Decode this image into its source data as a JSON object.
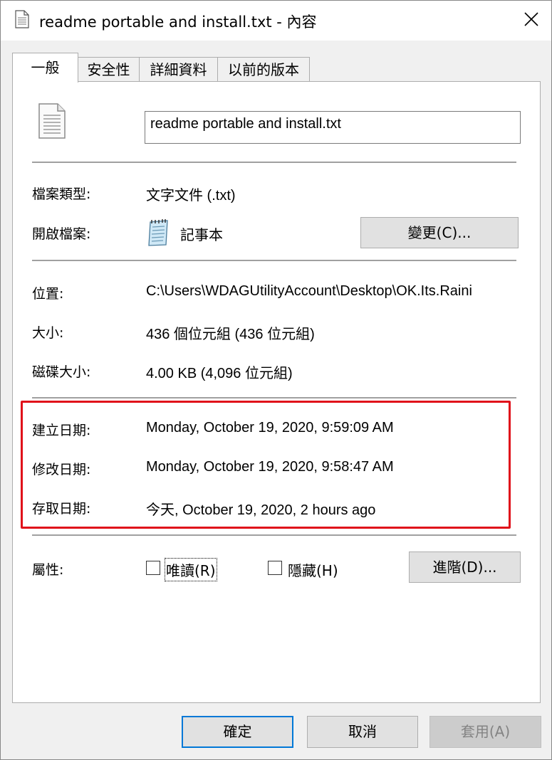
{
  "window": {
    "title": "readme portable and install.txt - 內容"
  },
  "tabs": [
    {
      "label": "一般",
      "active": true
    },
    {
      "label": "安全性",
      "active": false
    },
    {
      "label": "詳細資料",
      "active": false
    },
    {
      "label": "以前的版本",
      "active": false
    }
  ],
  "general": {
    "file_name": "readme portable and install.txt",
    "file_type_label": "檔案類型:",
    "file_type_value": "文字文件 (.txt)",
    "opens_with_label": "開啟檔案:",
    "opens_with_value": "記事本",
    "change_button": "變更(C)...",
    "location_label": "位置:",
    "location_value": "C:\\Users\\WDAGUtilityAccount\\Desktop\\OK.Its.Raini",
    "size_label": "大小:",
    "size_value": "436 個位元組 (436 位元組)",
    "size_on_disk_label": "磁碟大小:",
    "size_on_disk_value": "4.00 KB (4,096 位元組)",
    "created_label": "建立日期:",
    "created_value": "Monday, October 19, 2020, 9:59:09 AM",
    "modified_label": "修改日期:",
    "modified_value": "Monday, October 19, 2020, 9:58:47 AM",
    "accessed_label": "存取日期:",
    "accessed_value": "今天, October 19, 2020, 2 hours ago",
    "attributes_label": "屬性:",
    "readonly_label": "唯讀(R)",
    "readonly_checked": false,
    "hidden_label": "隱藏(H)",
    "hidden_checked": false,
    "advanced_button": "進階(D)..."
  },
  "footer": {
    "ok_button": "確定",
    "cancel_button": "取消",
    "apply_button": "套用(A)"
  },
  "colors": {
    "highlight_border": "#e0101a",
    "default_button_border": "#0078d7"
  }
}
